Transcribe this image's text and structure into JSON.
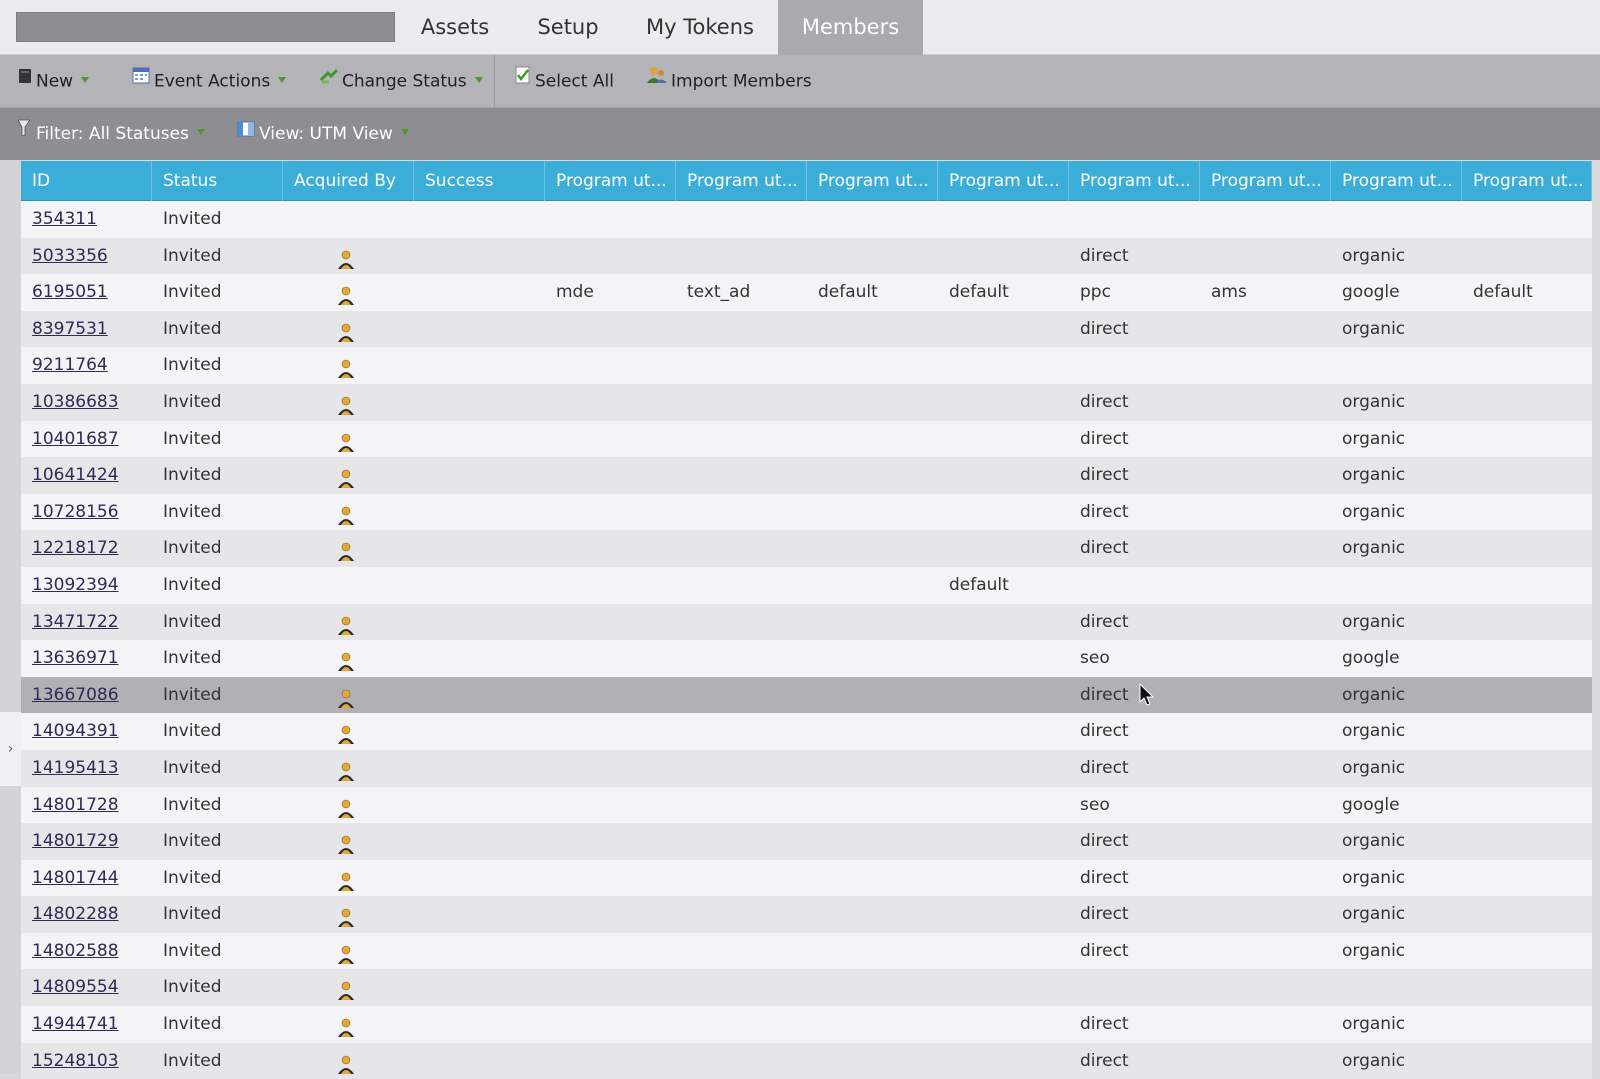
{
  "tabs": {
    "items": [
      {
        "label": "Assets"
      },
      {
        "label": "Setup"
      },
      {
        "label": "My Tokens"
      },
      {
        "label": "Members",
        "active": true
      }
    ]
  },
  "toolbar": {
    "new_label": "New",
    "event_actions_label": "Event Actions",
    "change_status_label": "Change Status",
    "select_all_label": "Select All",
    "import_members_label": "Import Members"
  },
  "filterbar": {
    "filter_label": "Filter: All Statuses",
    "view_label": "View: UTM View"
  },
  "colors": {
    "header_blue": "#3aaed8",
    "active_tab": "#a9a9ae",
    "dropdown_caret": "#4a9a2e"
  },
  "table": {
    "columns": [
      "ID",
      "Status",
      "Acquired By",
      "Success",
      "Program ut...",
      "Program ut...",
      "Program ut...",
      "Program ut...",
      "Program ut...",
      "Program ut...",
      "Program ut...",
      "Program ut..."
    ],
    "rows": [
      {
        "id": "354311",
        "status": "Invited",
        "acquired_icon": false,
        "p1": "",
        "p2": "",
        "p3": "",
        "p4": "",
        "p5": "",
        "p6": "",
        "p7": "",
        "p8": ""
      },
      {
        "id": "5033356",
        "status": "Invited",
        "acquired_icon": true,
        "p1": "",
        "p2": "",
        "p3": "",
        "p4": "",
        "p5": "direct",
        "p6": "",
        "p7": "organic",
        "p8": ""
      },
      {
        "id": "6195051",
        "status": "Invited",
        "acquired_icon": true,
        "p1": "mde",
        "p2": "text_ad",
        "p3": "default",
        "p4": "default",
        "p5": "ppc",
        "p6": "ams",
        "p7": "google",
        "p8": "default"
      },
      {
        "id": "8397531",
        "status": "Invited",
        "acquired_icon": true,
        "p1": "",
        "p2": "",
        "p3": "",
        "p4": "",
        "p5": "direct",
        "p6": "",
        "p7": "organic",
        "p8": ""
      },
      {
        "id": "9211764",
        "status": "Invited",
        "acquired_icon": true,
        "p1": "",
        "p2": "",
        "p3": "",
        "p4": "",
        "p5": "",
        "p6": "",
        "p7": "",
        "p8": ""
      },
      {
        "id": "10386683",
        "status": "Invited",
        "acquired_icon": true,
        "p1": "",
        "p2": "",
        "p3": "",
        "p4": "",
        "p5": "direct",
        "p6": "",
        "p7": "organic",
        "p8": ""
      },
      {
        "id": "10401687",
        "status": "Invited",
        "acquired_icon": true,
        "p1": "",
        "p2": "",
        "p3": "",
        "p4": "",
        "p5": "direct",
        "p6": "",
        "p7": "organic",
        "p8": ""
      },
      {
        "id": "10641424",
        "status": "Invited",
        "acquired_icon": true,
        "p1": "",
        "p2": "",
        "p3": "",
        "p4": "",
        "p5": "direct",
        "p6": "",
        "p7": "organic",
        "p8": ""
      },
      {
        "id": "10728156",
        "status": "Invited",
        "acquired_icon": true,
        "p1": "",
        "p2": "",
        "p3": "",
        "p4": "",
        "p5": "direct",
        "p6": "",
        "p7": "organic",
        "p8": ""
      },
      {
        "id": "12218172",
        "status": "Invited",
        "acquired_icon": true,
        "p1": "",
        "p2": "",
        "p3": "",
        "p4": "",
        "p5": "direct",
        "p6": "",
        "p7": "organic",
        "p8": ""
      },
      {
        "id": "13092394",
        "status": "Invited",
        "acquired_icon": false,
        "p1": "",
        "p2": "",
        "p3": "",
        "p4": "default",
        "p5": "",
        "p6": "",
        "p7": "",
        "p8": ""
      },
      {
        "id": "13471722",
        "status": "Invited",
        "acquired_icon": true,
        "p1": "",
        "p2": "",
        "p3": "",
        "p4": "",
        "p5": "direct",
        "p6": "",
        "p7": "organic",
        "p8": ""
      },
      {
        "id": "13636971",
        "status": "Invited",
        "acquired_icon": true,
        "p1": "",
        "p2": "",
        "p3": "",
        "p4": "",
        "p5": "seo",
        "p6": "",
        "p7": "google",
        "p8": ""
      },
      {
        "id": "13667086",
        "status": "Invited",
        "acquired_icon": true,
        "p1": "",
        "p2": "",
        "p3": "",
        "p4": "",
        "p5": "direct",
        "p6": "",
        "p7": "organic",
        "p8": "",
        "selected": true
      },
      {
        "id": "14094391",
        "status": "Invited",
        "acquired_icon": true,
        "p1": "",
        "p2": "",
        "p3": "",
        "p4": "",
        "p5": "direct",
        "p6": "",
        "p7": "organic",
        "p8": ""
      },
      {
        "id": "14195413",
        "status": "Invited",
        "acquired_icon": true,
        "p1": "",
        "p2": "",
        "p3": "",
        "p4": "",
        "p5": "direct",
        "p6": "",
        "p7": "organic",
        "p8": ""
      },
      {
        "id": "14801728",
        "status": "Invited",
        "acquired_icon": true,
        "p1": "",
        "p2": "",
        "p3": "",
        "p4": "",
        "p5": "seo",
        "p6": "",
        "p7": "google",
        "p8": ""
      },
      {
        "id": "14801729",
        "status": "Invited",
        "acquired_icon": true,
        "p1": "",
        "p2": "",
        "p3": "",
        "p4": "",
        "p5": "direct",
        "p6": "",
        "p7": "organic",
        "p8": ""
      },
      {
        "id": "14801744",
        "status": "Invited",
        "acquired_icon": true,
        "p1": "",
        "p2": "",
        "p3": "",
        "p4": "",
        "p5": "direct",
        "p6": "",
        "p7": "organic",
        "p8": ""
      },
      {
        "id": "14802288",
        "status": "Invited",
        "acquired_icon": true,
        "p1": "",
        "p2": "",
        "p3": "",
        "p4": "",
        "p5": "direct",
        "p6": "",
        "p7": "organic",
        "p8": ""
      },
      {
        "id": "14802588",
        "status": "Invited",
        "acquired_icon": true,
        "p1": "",
        "p2": "",
        "p3": "",
        "p4": "",
        "p5": "direct",
        "p6": "",
        "p7": "organic",
        "p8": ""
      },
      {
        "id": "14809554",
        "status": "Invited",
        "acquired_icon": true,
        "p1": "",
        "p2": "",
        "p3": "",
        "p4": "",
        "p5": "",
        "p6": "",
        "p7": "",
        "p8": ""
      },
      {
        "id": "14944741",
        "status": "Invited",
        "acquired_icon": true,
        "p1": "",
        "p2": "",
        "p3": "",
        "p4": "",
        "p5": "direct",
        "p6": "",
        "p7": "organic",
        "p8": ""
      },
      {
        "id": "15248103",
        "status": "Invited",
        "acquired_icon": true,
        "p1": "",
        "p2": "",
        "p3": "",
        "p4": "",
        "p5": "direct",
        "p6": "",
        "p7": "organic",
        "p8": ""
      }
    ]
  }
}
